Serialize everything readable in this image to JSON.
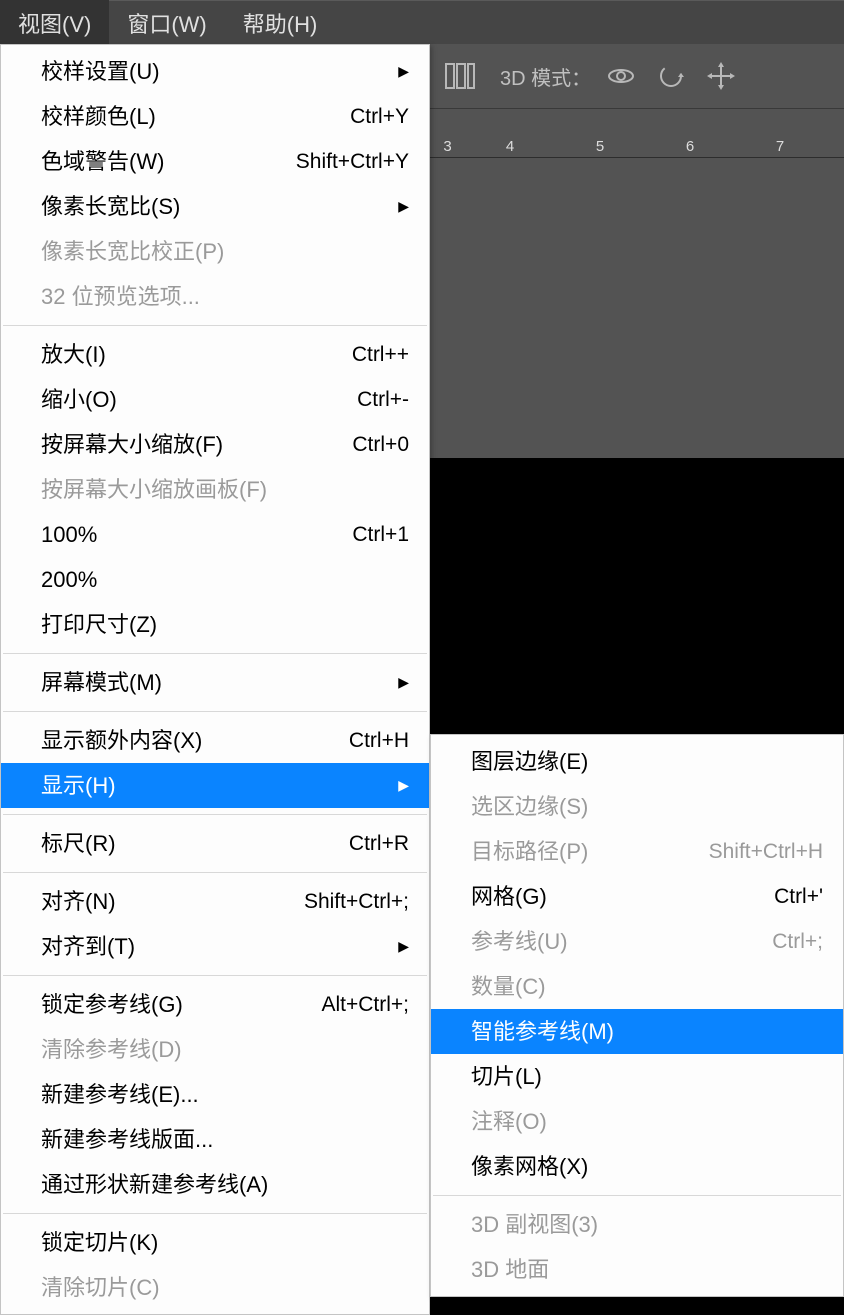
{
  "menubar": {
    "items": [
      {
        "label": "视图(V)",
        "active": true
      },
      {
        "label": "窗口(W)",
        "active": false
      },
      {
        "label": "帮助(H)",
        "active": false
      }
    ]
  },
  "toolbar": {
    "mode_label": "3D 模式："
  },
  "ruler": {
    "ticks": [
      "3",
      "4",
      "5",
      "6",
      "7"
    ]
  },
  "view_menu": [
    {
      "type": "item",
      "label": "校样设置(U)",
      "shortcut": "",
      "arrow": true,
      "disabled": false
    },
    {
      "type": "item",
      "label": "校样颜色(L)",
      "shortcut": "Ctrl+Y",
      "arrow": false,
      "disabled": false
    },
    {
      "type": "item",
      "label": "色域警告(W)",
      "shortcut": "Shift+Ctrl+Y",
      "arrow": false,
      "disabled": false
    },
    {
      "type": "item",
      "label": "像素长宽比(S)",
      "shortcut": "",
      "arrow": true,
      "disabled": false
    },
    {
      "type": "item",
      "label": "像素长宽比校正(P)",
      "shortcut": "",
      "arrow": false,
      "disabled": true
    },
    {
      "type": "item",
      "label": "32 位预览选项...",
      "shortcut": "",
      "arrow": false,
      "disabled": true
    },
    {
      "type": "sep"
    },
    {
      "type": "item",
      "label": "放大(I)",
      "shortcut": "Ctrl++",
      "arrow": false,
      "disabled": false
    },
    {
      "type": "item",
      "label": "缩小(O)",
      "shortcut": "Ctrl+-",
      "arrow": false,
      "disabled": false
    },
    {
      "type": "item",
      "label": "按屏幕大小缩放(F)",
      "shortcut": "Ctrl+0",
      "arrow": false,
      "disabled": false
    },
    {
      "type": "item",
      "label": "按屏幕大小缩放画板(F)",
      "shortcut": "",
      "arrow": false,
      "disabled": true
    },
    {
      "type": "item",
      "label": "100%",
      "shortcut": "Ctrl+1",
      "arrow": false,
      "disabled": false
    },
    {
      "type": "item",
      "label": "200%",
      "shortcut": "",
      "arrow": false,
      "disabled": false
    },
    {
      "type": "item",
      "label": "打印尺寸(Z)",
      "shortcut": "",
      "arrow": false,
      "disabled": false
    },
    {
      "type": "sep"
    },
    {
      "type": "item",
      "label": "屏幕模式(M)",
      "shortcut": "",
      "arrow": true,
      "disabled": false
    },
    {
      "type": "sep"
    },
    {
      "type": "item",
      "label": "显示额外内容(X)",
      "shortcut": "Ctrl+H",
      "arrow": false,
      "disabled": false
    },
    {
      "type": "item",
      "label": "显示(H)",
      "shortcut": "",
      "arrow": true,
      "disabled": false,
      "highlight": true
    },
    {
      "type": "sep"
    },
    {
      "type": "item",
      "label": "标尺(R)",
      "shortcut": "Ctrl+R",
      "arrow": false,
      "disabled": false
    },
    {
      "type": "sep"
    },
    {
      "type": "item",
      "label": "对齐(N)",
      "shortcut": "Shift+Ctrl+;",
      "arrow": false,
      "disabled": false
    },
    {
      "type": "item",
      "label": "对齐到(T)",
      "shortcut": "",
      "arrow": true,
      "disabled": false
    },
    {
      "type": "sep"
    },
    {
      "type": "item",
      "label": "锁定参考线(G)",
      "shortcut": "Alt+Ctrl+;",
      "arrow": false,
      "disabled": false
    },
    {
      "type": "item",
      "label": "清除参考线(D)",
      "shortcut": "",
      "arrow": false,
      "disabled": true
    },
    {
      "type": "item",
      "label": "新建参考线(E)...",
      "shortcut": "",
      "arrow": false,
      "disabled": false
    },
    {
      "type": "item",
      "label": "新建参考线版面...",
      "shortcut": "",
      "arrow": false,
      "disabled": false
    },
    {
      "type": "item",
      "label": "通过形状新建参考线(A)",
      "shortcut": "",
      "arrow": false,
      "disabled": false
    },
    {
      "type": "sep"
    },
    {
      "type": "item",
      "label": "锁定切片(K)",
      "shortcut": "",
      "arrow": false,
      "disabled": false
    },
    {
      "type": "item",
      "label": "清除切片(C)",
      "shortcut": "",
      "arrow": false,
      "disabled": true
    }
  ],
  "show_submenu": [
    {
      "type": "item",
      "label": "图层边缘(E)",
      "shortcut": "",
      "arrow": false,
      "disabled": false
    },
    {
      "type": "item",
      "label": "选区边缘(S)",
      "shortcut": "",
      "arrow": false,
      "disabled": true
    },
    {
      "type": "item",
      "label": "目标路径(P)",
      "shortcut": "Shift+Ctrl+H",
      "arrow": false,
      "disabled": true
    },
    {
      "type": "item",
      "label": "网格(G)",
      "shortcut": "Ctrl+'",
      "arrow": false,
      "disabled": false
    },
    {
      "type": "item",
      "label": "参考线(U)",
      "shortcut": "Ctrl+;",
      "arrow": false,
      "disabled": true
    },
    {
      "type": "item",
      "label": "数量(C)",
      "shortcut": "",
      "arrow": false,
      "disabled": true
    },
    {
      "type": "item",
      "label": "智能参考线(M)",
      "shortcut": "",
      "arrow": false,
      "disabled": false,
      "highlight": true
    },
    {
      "type": "item",
      "label": "切片(L)",
      "shortcut": "",
      "arrow": false,
      "disabled": false
    },
    {
      "type": "item",
      "label": "注释(O)",
      "shortcut": "",
      "arrow": false,
      "disabled": true
    },
    {
      "type": "item",
      "label": "像素网格(X)",
      "shortcut": "",
      "arrow": false,
      "disabled": false
    },
    {
      "type": "sep"
    },
    {
      "type": "item",
      "label": "3D 副视图(3)",
      "shortcut": "",
      "arrow": false,
      "disabled": true
    },
    {
      "type": "item",
      "label": "3D 地面",
      "shortcut": "",
      "arrow": false,
      "disabled": true
    }
  ]
}
